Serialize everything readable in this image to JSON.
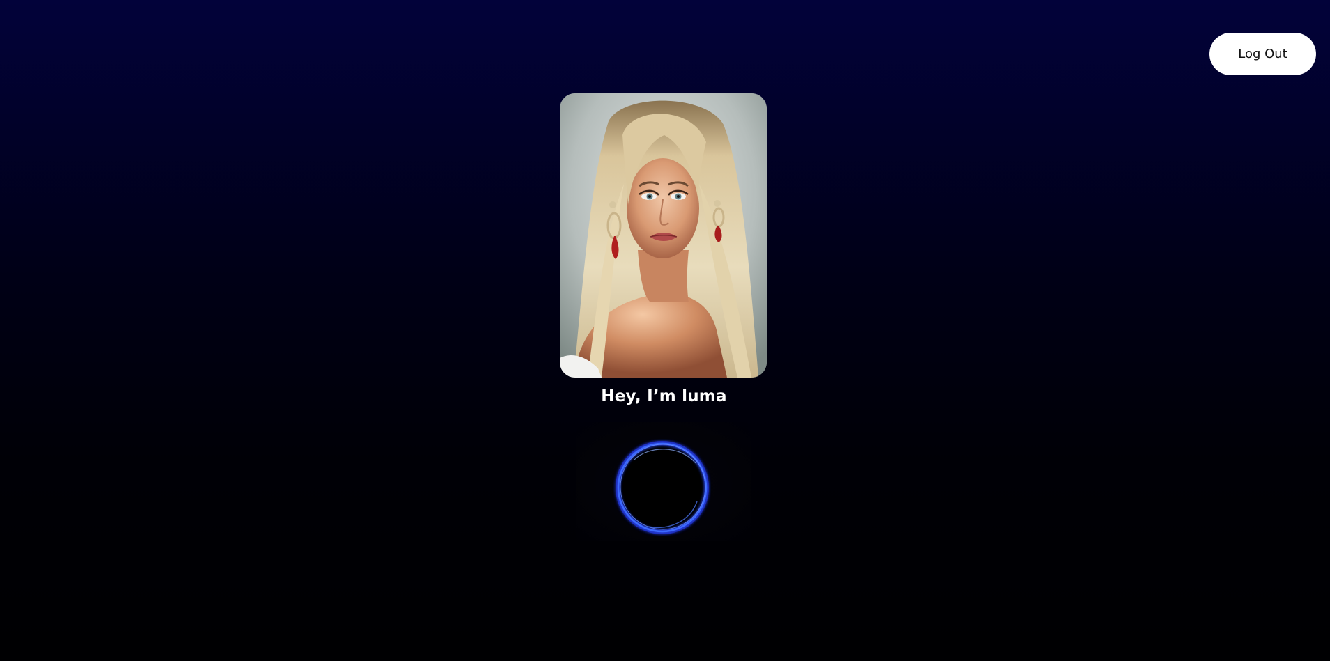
{
  "header": {
    "logout_label": "Log Out"
  },
  "profile": {
    "greeting": "Hey, I’m luma",
    "portrait_alt": "luma portrait"
  },
  "voice": {
    "icon": "voice-orb-icon"
  },
  "colors": {
    "background_top": "#02023a",
    "background_bottom": "#000002",
    "button_bg": "#ffffff",
    "orb_ring": "#2a4dff"
  }
}
